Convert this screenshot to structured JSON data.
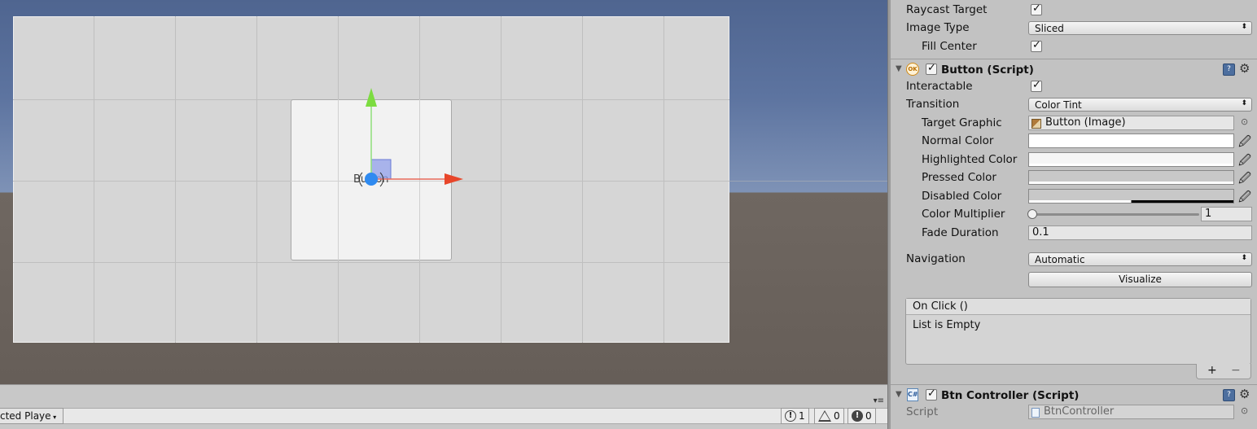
{
  "scene": {
    "button_label": "Button"
  },
  "statusbar": {
    "player_dropdown": "cted Playe",
    "log_count": "1",
    "warning_count": "0",
    "error_count": "0"
  },
  "inspector": {
    "image": {
      "raycast_target_label": "Raycast Target",
      "raycast_target_checked": true,
      "image_type_label": "Image Type",
      "image_type_value": "Sliced",
      "fill_center_label": "Fill Center",
      "fill_center_checked": true
    },
    "button_component": {
      "title": "Button (Script)",
      "enabled": true,
      "interactable_label": "Interactable",
      "transition_label": "Transition",
      "transition_value": "Color Tint",
      "target_graphic_label": "Target Graphic",
      "target_graphic_value": "Button (Image)",
      "normal_color_label": "Normal Color",
      "highlighted_color_label": "Highlighted Color",
      "pressed_color_label": "Pressed Color",
      "disabled_color_label": "Disabled Color",
      "color_multiplier_label": "Color Multiplier",
      "color_multiplier_value": "1",
      "fade_duration_label": "Fade Duration",
      "fade_duration_value": "0.1",
      "navigation_label": "Navigation",
      "navigation_value": "Automatic",
      "visualize_label": "Visualize",
      "on_click_header": "On Click ()",
      "on_click_empty": "List is Empty",
      "add_label": "+",
      "remove_label": "−"
    },
    "btn_controller": {
      "title": "Btn Controller (Script)",
      "script_label": "Script",
      "script_value": "BtnController"
    }
  },
  "colors": {
    "normal": "#ffffff",
    "highlighted": "#f5f5f5",
    "pressed": "#c8c8c8",
    "disabled": "#c8c8c8",
    "scene_sky": "#5d74a0",
    "scene_ground": "#6a625c"
  },
  "icons": [
    "move-gizmo-icon",
    "ok-icon",
    "script-icon",
    "help-book-icon",
    "gear-icon",
    "eyedropper-icon",
    "object-picker-icon",
    "info-icon",
    "warning-icon",
    "error-icon"
  ]
}
